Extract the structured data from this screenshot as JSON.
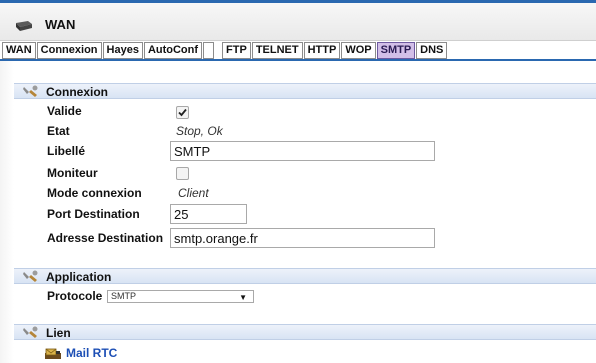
{
  "window": {
    "title": "WAN",
    "icon": "router-icon"
  },
  "tabs": [
    {
      "label": "WAN"
    },
    {
      "label": "Connexion"
    },
    {
      "label": "Hayes"
    },
    {
      "label": "AutoConf"
    },
    {
      "label": ""
    },
    {
      "label": "FTP"
    },
    {
      "label": "TELNET"
    },
    {
      "label": "HTTP"
    },
    {
      "label": "WOP"
    },
    {
      "label": "SMTP",
      "active": true
    },
    {
      "label": "DNS"
    }
  ],
  "sections": {
    "connexion": {
      "title": "Connexion",
      "valide_label": "Valide",
      "valide_checked": true,
      "etat_label": "Etat",
      "etat_value": "Stop, Ok",
      "libelle_label": "Libellé",
      "libelle_value": "SMTP",
      "moniteur_label": "Moniteur",
      "moniteur_checked": false,
      "mode_label": "Mode connexion",
      "mode_value": "Client",
      "port_label": "Port Destination",
      "port_value": "25",
      "adresse_label": "Adresse Destination",
      "adresse_value": "smtp.orange.fr"
    },
    "application": {
      "title": "Application",
      "protocole_label": "Protocole",
      "protocole_value": "SMTP",
      "dropdown_arrow": "▼"
    },
    "lien": {
      "title": "Lien",
      "link_label": "Mail RTC",
      "link_icon": "mail-icon"
    }
  },
  "colors": {
    "accent_blue": "#2a68b0",
    "active_tab": "#d2bfe8",
    "section_header": "#dce6f5",
    "link": "#1d4fb5"
  }
}
